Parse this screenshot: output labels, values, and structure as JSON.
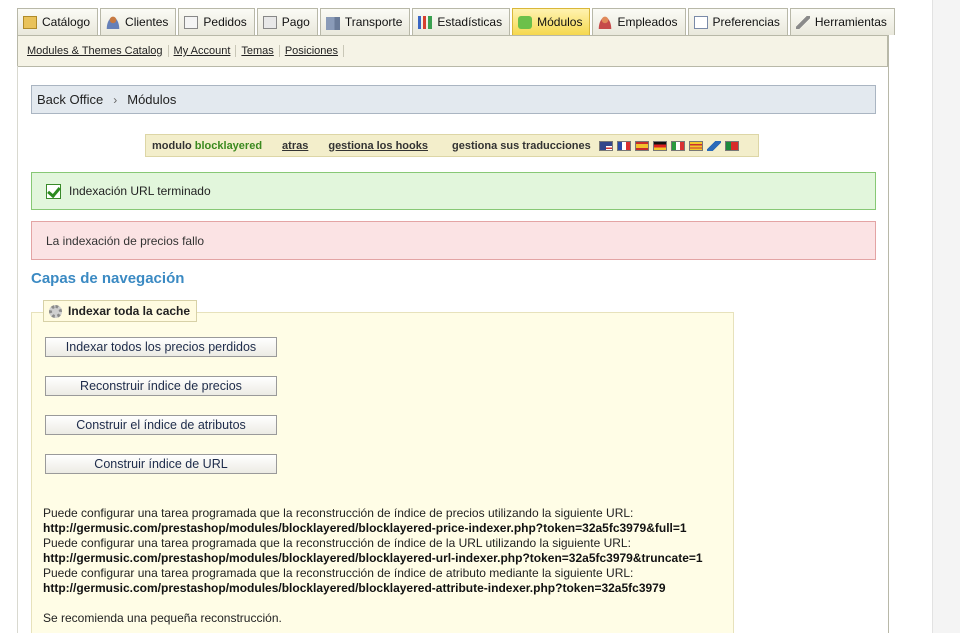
{
  "tabs": [
    {
      "label": "Catálogo",
      "icon": "folder-icon",
      "active": false
    },
    {
      "label": "Clientes",
      "icon": "user-icon",
      "active": false
    },
    {
      "label": "Pedidos",
      "icon": "document-icon",
      "active": false
    },
    {
      "label": "Pago",
      "icon": "payment-icon",
      "active": false
    },
    {
      "label": "Transporte",
      "icon": "truck-icon",
      "active": false
    },
    {
      "label": "Estadísticas",
      "icon": "chart-icon",
      "active": false
    },
    {
      "label": "Módulos",
      "icon": "puzzle-icon",
      "active": true
    },
    {
      "label": "Empleados",
      "icon": "employee-icon",
      "active": false
    },
    {
      "label": "Preferencias",
      "icon": "preferences-icon",
      "active": false
    },
    {
      "label": "Herramientas",
      "icon": "tools-icon",
      "active": false
    }
  ],
  "subtabs": [
    "Modules & Themes Catalog",
    "My Account",
    "Temas",
    "Posiciones"
  ],
  "breadcrumb": {
    "root": "Back Office",
    "sep": "›",
    "current": "Módulos"
  },
  "module_bar": {
    "prefix": "modulo",
    "module": "blocklayered",
    "back": "atras",
    "hooks": "gestiona los hooks",
    "translations": "gestiona sus traducciones",
    "flags": [
      "en",
      "fr",
      "es",
      "de",
      "it",
      "ca",
      "xx",
      "pt"
    ]
  },
  "success": {
    "text": "Indexación URL terminado"
  },
  "error": {
    "text": "La indexación de precios fallo"
  },
  "section_title": "Capas de navegación",
  "fieldset": {
    "legend": "Indexar toda la cache",
    "buttons": {
      "b1": "Indexar todos los precios perdidos",
      "b2": "Reconstruir índice de precios",
      "b3": "Construir el índice de atributos",
      "b4": "Construir índice de URL"
    },
    "info": {
      "l1": "Puede configurar una tarea programada que la reconstrucción de índice de precios utilizando la siguiente URL:",
      "u1": "http://germusic.com/prestashop/modules/blocklayered/blocklayered-price-indexer.php?token=32a5fc3979&full=1",
      "l2": "Puede configurar una tarea programada que la reconstrucción de índice de la URL utilizando la siguiente URL:",
      "u2": "http://germusic.com/prestashop/modules/blocklayered/blocklayered-url-indexer.php?token=32a5fc3979&truncate=1",
      "l3": "Puede configurar una tarea programada que la reconstrucción de índice de atributo mediante la siguiente URL:",
      "u3": "http://germusic.com/prestashop/modules/blocklayered/blocklayered-attribute-indexer.php?token=32a5fc3979",
      "note": "Se recomienda una pequeña reconstrucción."
    }
  }
}
